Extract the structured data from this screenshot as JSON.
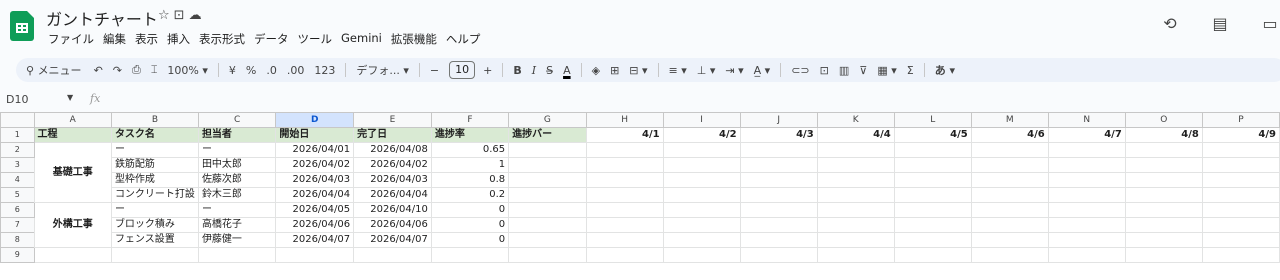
{
  "doc": {
    "title": "ガントチャート",
    "title_icons": "☆ ⊡ ⌂"
  },
  "menu": [
    "ファイル",
    "編集",
    "表示",
    "挿入",
    "表示形式",
    "データ",
    "ツール",
    "Gemini",
    "拡張機能",
    "ヘルプ"
  ],
  "right_icons": [
    "history-icon",
    "comment-icon",
    "meet-icon"
  ],
  "toolbar": {
    "search": "メニュー",
    "zoom": "100%",
    "currency": "¥",
    "percent": "%",
    "dec_decrease": ".0",
    "dec_increase": ".00",
    "number_format": "123",
    "font": "デフォ...",
    "font_size": "10",
    "ime": "あ"
  },
  "formula": {
    "cell_ref": "D10",
    "fx": "fx",
    "value": ""
  },
  "columns": [
    "A",
    "B",
    "C",
    "D",
    "E",
    "F",
    "G",
    "H",
    "I",
    "J",
    "K",
    "L",
    "M",
    "N",
    "O",
    "P"
  ],
  "selected_column": "D",
  "row_numbers": [
    "1",
    "2",
    "3",
    "4",
    "5",
    "6",
    "7",
    "8",
    "9"
  ],
  "header_row": {
    "A": "工程",
    "B": "タスク名",
    "C": "担当者",
    "D": "開始日",
    "E": "完了日",
    "F": "進捗率",
    "G": "進捗バー",
    "dates": [
      "4/1",
      "4/2",
      "4/3",
      "4/4",
      "4/5",
      "4/6",
      "4/7",
      "4/8",
      "4/9"
    ]
  },
  "processes": [
    {
      "name": "基礎工事",
      "rows": [
        2,
        3,
        4,
        5
      ]
    },
    {
      "name": "外構工事",
      "rows": [
        6,
        7,
        8
      ]
    }
  ],
  "tasks": [
    {
      "task": "ー",
      "owner": "ー",
      "start": "2026/04/01",
      "end": "2026/04/08",
      "progress": "0.65"
    },
    {
      "task": "鉄筋配筋",
      "owner": "田中太郎",
      "start": "2026/04/02",
      "end": "2026/04/02",
      "progress": "1"
    },
    {
      "task": "型枠作成",
      "owner": "佐藤次郎",
      "start": "2026/04/03",
      "end": "2026/04/03",
      "progress": "0.8"
    },
    {
      "task": "コンクリート打設",
      "owner": "鈴木三郎",
      "start": "2026/04/04",
      "end": "2026/04/04",
      "progress": "0.2"
    },
    {
      "task": "ー",
      "owner": "ー",
      "start": "2026/04/05",
      "end": "2026/04/10",
      "progress": "0"
    },
    {
      "task": "ブロック積み",
      "owner": "高橋花子",
      "start": "2026/04/06",
      "end": "2026/04/06",
      "progress": "0"
    },
    {
      "task": "フェンス設置",
      "owner": "伊藤健一",
      "start": "2026/04/07",
      "end": "2026/04/07",
      "progress": "0"
    }
  ]
}
